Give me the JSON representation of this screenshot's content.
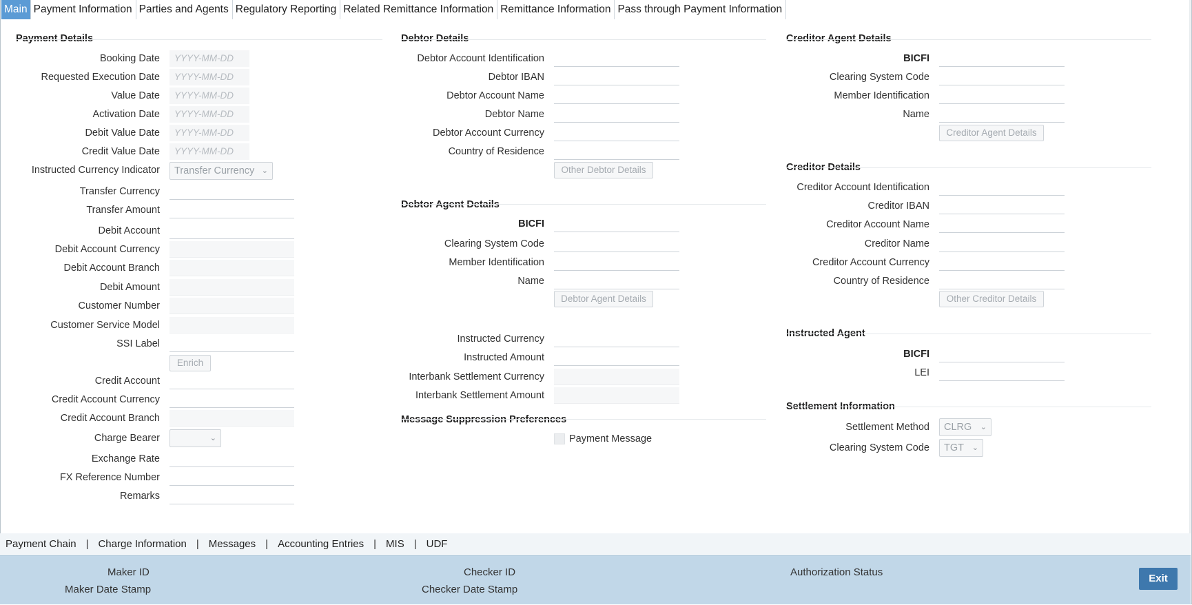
{
  "tabs": [
    "Main",
    "Payment Information",
    "Parties and Agents",
    "Regulatory Reporting",
    "Related Remittance Information",
    "Remittance Information",
    "Pass through Payment Information"
  ],
  "payment_details": {
    "title": "Payment Details",
    "date_placeholder": "YYYY-MM-DD",
    "booking_date": "Booking Date",
    "requested_execution_date": "Requested Execution Date",
    "value_date": "Value Date",
    "activation_date": "Activation Date",
    "debit_value_date": "Debit Value Date",
    "credit_value_date": "Credit Value Date",
    "instructed_currency_indicator": "Instructed Currency Indicator",
    "instructed_currency_indicator_value": "Transfer Currency",
    "transfer_currency": "Transfer Currency",
    "transfer_amount": "Transfer Amount",
    "debit_account": "Debit Account",
    "debit_account_currency": "Debit Account Currency",
    "debit_account_branch": "Debit Account Branch",
    "debit_amount": "Debit Amount",
    "customer_number": "Customer Number",
    "customer_service_model": "Customer Service Model",
    "ssi_label": "SSI Label",
    "enrich_button": "Enrich",
    "credit_account": "Credit Account",
    "credit_account_currency": "Credit Account Currency",
    "credit_account_branch": "Credit Account Branch",
    "charge_bearer": "Charge Bearer",
    "charge_bearer_value": "",
    "exchange_rate": "Exchange Rate",
    "fx_reference_number": "FX Reference Number",
    "remarks": "Remarks"
  },
  "debtor_details": {
    "title": "Debtor Details",
    "account_identification": "Debtor Account Identification",
    "iban": "Debtor IBAN",
    "account_name": "Debtor Account Name",
    "name": "Debtor Name",
    "account_currency": "Debtor Account Currency",
    "country_of_residence": "Country of Residence",
    "other_button": "Other Debtor Details"
  },
  "debtor_agent_details": {
    "title": "Debtor Agent Details",
    "bicfi": "BICFI",
    "clearing_system_code": "Clearing System Code",
    "member_identification": "Member Identification",
    "name": "Name",
    "button": "Debtor Agent Details",
    "instructed_currency": "Instructed Currency",
    "instructed_amount": "Instructed Amount",
    "interbank_settlement_currency": "Interbank Settlement Currency",
    "interbank_settlement_amount": "Interbank Settlement Amount"
  },
  "message_suppression": {
    "title": "Message Suppression Preferences",
    "payment_message": "Payment Message"
  },
  "creditor_agent_details": {
    "title": "Creditor Agent Details",
    "bicfi": "BICFI",
    "clearing_system_code": "Clearing System Code",
    "member_identification": "Member Identification",
    "name": "Name",
    "button": "Creditor Agent Details"
  },
  "creditor_details": {
    "title": "Creditor Details",
    "account_identification": "Creditor Account Identification",
    "iban": "Creditor IBAN",
    "account_name": "Creditor Account Name",
    "name": "Creditor Name",
    "account_currency": "Creditor Account Currency",
    "country_of_residence": "Country of Residence",
    "other_button": "Other Creditor Details"
  },
  "instructed_agent": {
    "title": "Instructed Agent",
    "bicfi": "BICFI",
    "lei": "LEI"
  },
  "settlement_information": {
    "title": "Settlement Information",
    "settlement_method": "Settlement Method",
    "settlement_method_value": "CLRG",
    "clearing_system_code": "Clearing System Code",
    "clearing_system_code_value": "TGT"
  },
  "sublinks": [
    "Payment Chain",
    "Charge Information",
    "Messages",
    "Accounting Entries",
    "MIS",
    "UDF"
  ],
  "footer": {
    "maker_id": "Maker ID",
    "maker_date_stamp": "Maker Date Stamp",
    "checker_id": "Checker ID",
    "checker_date_stamp": "Checker Date Stamp",
    "authorization_status": "Authorization Status",
    "exit": "Exit"
  }
}
